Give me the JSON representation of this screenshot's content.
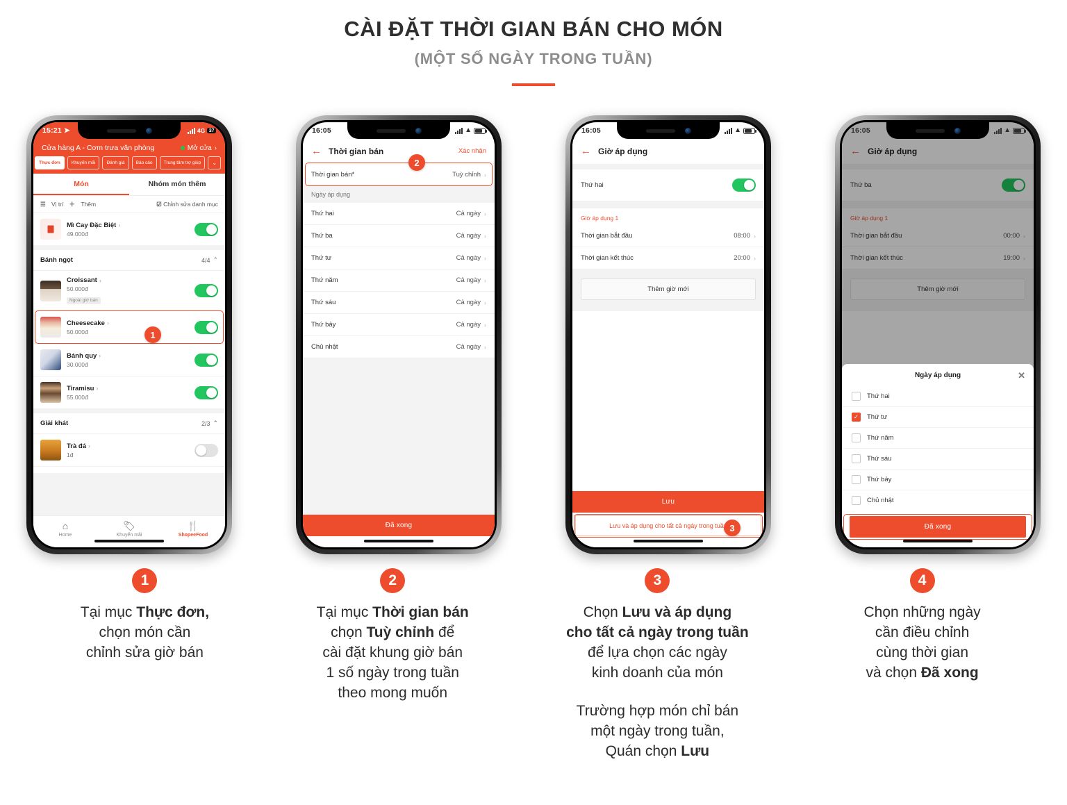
{
  "header": {
    "title": "CÀI ĐẶT THỜI GIAN BÁN CHO MÓN",
    "subtitle": "(MỘT SỐ NGÀY TRONG TUẦN)"
  },
  "colors": {
    "accent": "#ee4d2d",
    "toggle_on": "#22c55e",
    "grey_bg": "#f3f3f3"
  },
  "phone1": {
    "status": {
      "time": "15:21",
      "network": "4G",
      "battery": "37"
    },
    "shop": {
      "name": "Cửa hàng A - Cơm trưa văn phòng",
      "status": "Mở cửa"
    },
    "tabs": [
      {
        "label": "Thực đơn",
        "active": true
      },
      {
        "label": "Khuyến mãi",
        "active": false
      },
      {
        "label": "Đánh giá",
        "active": false
      },
      {
        "label": "Báo cáo",
        "active": false
      },
      {
        "label": "Trung tâm trợ giúp",
        "active": false
      }
    ],
    "segments": [
      {
        "label": "Món",
        "active": true
      },
      {
        "label": "Nhóm món thêm",
        "active": false
      }
    ],
    "toolbar": {
      "position": "Vị trí",
      "add": "Thêm",
      "edit_category": "Chỉnh sửa danh mục"
    },
    "items": [
      {
        "name": "Mì Cay Đặc Biệt",
        "price": "49.000đ",
        "on": true,
        "badge": ""
      },
      {
        "name": "Croissant",
        "price": "50.000đ",
        "on": true,
        "badge": "Ngoài giờ bán"
      },
      {
        "name": "Cheesecake",
        "price": "50.000đ",
        "on": true,
        "badge": ""
      },
      {
        "name": "Bánh quy",
        "price": "30.000đ",
        "on": true,
        "badge": ""
      },
      {
        "name": "Tiramisu",
        "price": "55.000đ",
        "on": true,
        "badge": ""
      },
      {
        "name": "Trà đá",
        "price": "1đ",
        "on": false,
        "badge": ""
      }
    ],
    "groups": [
      {
        "label": "Bánh ngọt",
        "count": "4/4"
      },
      {
        "label": "Giải khát",
        "count": "2/3"
      }
    ],
    "bottom_nav": [
      {
        "label": "Home",
        "icon": "home-icon"
      },
      {
        "label": "Khuyến mãi",
        "icon": "tag-icon"
      },
      {
        "label": "ShopeeFood",
        "icon": "cutlery-icon"
      }
    ],
    "step": "1"
  },
  "phone2": {
    "status": {
      "time": "16:05"
    },
    "nav": {
      "title": "Thời gian bán",
      "action": "Xác nhận"
    },
    "main_row": {
      "label": "Thời gian bán*",
      "value": "Tuỳ chỉnh"
    },
    "section": "Ngày áp dụng",
    "days": [
      {
        "label": "Thứ hai",
        "value": "Cả ngày"
      },
      {
        "label": "Thứ ba",
        "value": "Cả ngày"
      },
      {
        "label": "Thứ tư",
        "value": "Cả ngày"
      },
      {
        "label": "Thứ năm",
        "value": "Cả ngày"
      },
      {
        "label": "Thứ sáu",
        "value": "Cả ngày"
      },
      {
        "label": "Thứ bảy",
        "value": "Cả ngày"
      },
      {
        "label": "Chủ nhật",
        "value": "Cả ngày"
      }
    ],
    "done_button": "Đã xong",
    "step": "2"
  },
  "phone3": {
    "status": {
      "time": "16:05"
    },
    "nav": {
      "title": "Giờ áp dụng"
    },
    "day_row": {
      "label": "Thứ hai",
      "on": true
    },
    "slot_title": "Giờ áp dụng 1",
    "start": {
      "label": "Thời gian bắt đầu",
      "value": "08:00"
    },
    "end": {
      "label": "Thời gian kết thúc",
      "value": "20:00"
    },
    "add_slot": "Thêm giờ mới",
    "save_button": "Lưu",
    "save_all_button": "Lưu và áp dụng cho tất cả ngày trong tuần",
    "step": "3"
  },
  "phone4": {
    "status": {
      "time": "16:05"
    },
    "nav": {
      "title": "Giờ áp dụng"
    },
    "day_row": {
      "label": "Thứ ba",
      "on": true
    },
    "slot_title": "Giờ áp dụng 1",
    "start": {
      "label": "Thời gian bắt đầu",
      "value": "00:00"
    },
    "end": {
      "label": "Thời gian kết thúc",
      "value": "19:00"
    },
    "add_slot": "Thêm giờ mới",
    "sheet": {
      "title": "Ngày áp dụng",
      "options": [
        {
          "label": "Thứ hai",
          "checked": false
        },
        {
          "label": "Thứ tư",
          "checked": true
        },
        {
          "label": "Thứ năm",
          "checked": false
        },
        {
          "label": "Thứ sáu",
          "checked": false
        },
        {
          "label": "Thứ bảy",
          "checked": false
        },
        {
          "label": "Chủ nhật",
          "checked": false
        }
      ],
      "done_button": "Đã xong"
    },
    "step": "4"
  },
  "captions": [
    {
      "num": "1",
      "lines": [
        [
          {
            "t": "Tại mục ",
            "b": false
          },
          {
            "t": "Thực đơn,",
            "b": true
          }
        ],
        [
          {
            "t": "chọn món cần",
            "b": false
          }
        ],
        [
          {
            "t": "chỉnh sửa giờ bán",
            "b": false
          }
        ]
      ],
      "lines2": []
    },
    {
      "num": "2",
      "lines": [
        [
          {
            "t": "Tại mục ",
            "b": false
          },
          {
            "t": "Thời gian bán",
            "b": true
          }
        ],
        [
          {
            "t": "chọn ",
            "b": false
          },
          {
            "t": "Tuỳ chỉnh",
            "b": true
          },
          {
            "t": " để",
            "b": false
          }
        ],
        [
          {
            "t": "cài đặt khung giờ bán",
            "b": false
          }
        ],
        [
          {
            "t": "1 số ngày trong tuần",
            "b": false
          }
        ],
        [
          {
            "t": "theo mong muốn",
            "b": false
          }
        ]
      ],
      "lines2": []
    },
    {
      "num": "3",
      "lines": [
        [
          {
            "t": "Chọn ",
            "b": false
          },
          {
            "t": "Lưu và áp dụng",
            "b": true
          }
        ],
        [
          {
            "t": "cho tất cả ngày trong tuần",
            "b": true
          }
        ],
        [
          {
            "t": "để lựa chọn các ngày",
            "b": false
          }
        ],
        [
          {
            "t": "kinh doanh của món",
            "b": false
          }
        ]
      ],
      "lines2": [
        [
          {
            "t": "Trường hợp món chỉ bán",
            "b": false
          }
        ],
        [
          {
            "t": "một ngày trong tuần,",
            "b": false
          }
        ],
        [
          {
            "t": "Quán chọn ",
            "b": false
          },
          {
            "t": "Lưu",
            "b": true
          }
        ]
      ]
    },
    {
      "num": "4",
      "lines": [
        [
          {
            "t": "Chọn những ngày",
            "b": false
          }
        ],
        [
          {
            "t": "cần điều chỉnh",
            "b": false
          }
        ],
        [
          {
            "t": "cùng thời gian",
            "b": false
          }
        ],
        [
          {
            "t": "và chọn ",
            "b": false
          },
          {
            "t": "Đã xong",
            "b": true
          }
        ]
      ],
      "lines2": []
    }
  ]
}
